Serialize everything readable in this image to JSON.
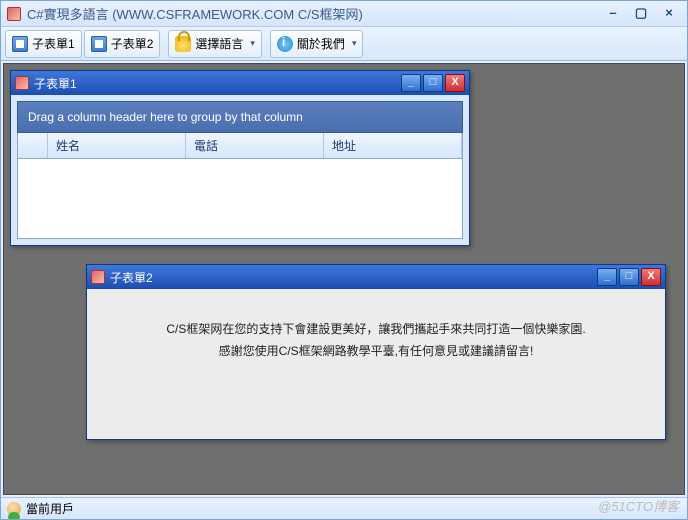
{
  "app": {
    "title": "C#實現多語言 (WWW.CSFRAMEWORK.COM C/S框架网)"
  },
  "toolbar": {
    "btn1": "子表單1",
    "btn2": "子表單2",
    "lang": "選擇語言",
    "about": "關於我們"
  },
  "child1": {
    "title": "子表單1",
    "group_hint": "Drag a column header here to group by that column",
    "cols": {
      "c1": "姓名",
      "c2": "電話",
      "c3": "地址"
    }
  },
  "child2": {
    "title": "子表單2",
    "line1": "C/S框架网在您的支持下會建設更美好，讓我們攜起手來共同打造一個快樂家園.",
    "line2": "感謝您使用C/S框架網路教學平臺,有任何意見或建議請留言!"
  },
  "status": {
    "user": "當前用戶"
  },
  "watermark": "@51CTO博客"
}
